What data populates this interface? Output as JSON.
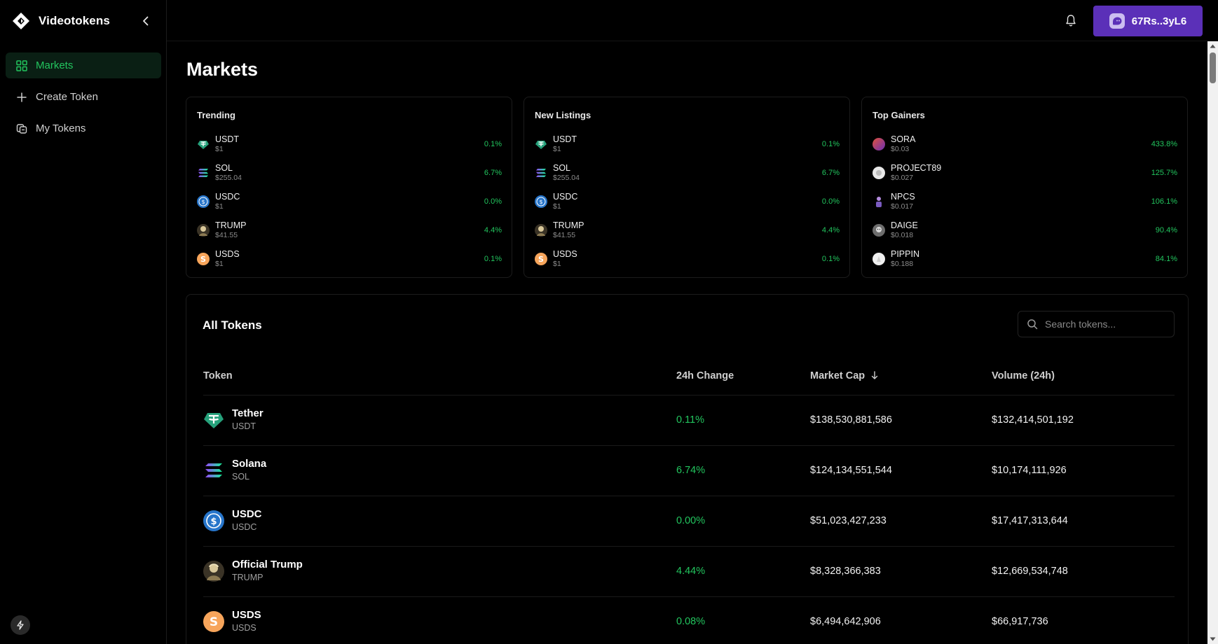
{
  "brand": {
    "name": "Videotokens",
    "logo_icon": "diamond-logo-icon"
  },
  "sidebar": {
    "items": [
      {
        "label": "Markets",
        "icon": "grid-icon",
        "active": true
      },
      {
        "label": "Create Token",
        "icon": "plus-icon",
        "active": false
      },
      {
        "label": "My Tokens",
        "icon": "coins-icon",
        "active": false
      }
    ]
  },
  "topbar": {
    "wallet_label": "67Rs..3yL6",
    "bell_icon": "bell-icon"
  },
  "page": {
    "title": "Markets"
  },
  "cards": [
    {
      "title": "Trending",
      "rows": [
        {
          "symbol": "USDT",
          "price": "$1",
          "change": "0.1%"
        },
        {
          "symbol": "SOL",
          "price": "$255.04",
          "change": "6.7%"
        },
        {
          "symbol": "USDC",
          "price": "$1",
          "change": "0.0%"
        },
        {
          "symbol": "TRUMP",
          "price": "$41.55",
          "change": "4.4%"
        },
        {
          "symbol": "USDS",
          "price": "$1",
          "change": "0.1%"
        }
      ]
    },
    {
      "title": "New Listings",
      "rows": [
        {
          "symbol": "USDT",
          "price": "$1",
          "change": "0.1%"
        },
        {
          "symbol": "SOL",
          "price": "$255.04",
          "change": "6.7%"
        },
        {
          "symbol": "USDC",
          "price": "$1",
          "change": "0.0%"
        },
        {
          "symbol": "TRUMP",
          "price": "$41.55",
          "change": "4.4%"
        },
        {
          "symbol": "USDS",
          "price": "$1",
          "change": "0.1%"
        }
      ]
    },
    {
      "title": "Top Gainers",
      "rows": [
        {
          "symbol": "SORA",
          "price": "$0.03",
          "change": "433.8%"
        },
        {
          "symbol": "PROJECT89",
          "price": "$0.027",
          "change": "125.7%"
        },
        {
          "symbol": "NPCS",
          "price": "$0.017",
          "change": "106.1%"
        },
        {
          "symbol": "DAIGE",
          "price": "$0.018",
          "change": "90.4%"
        },
        {
          "symbol": "PIPPIN",
          "price": "$0.188",
          "change": "84.1%"
        }
      ]
    }
  ],
  "all_tokens": {
    "title": "All Tokens",
    "search_placeholder": "Search tokens...",
    "columns": {
      "token": "Token",
      "change": "24h Change",
      "market_cap": "Market Cap",
      "volume": "Volume (24h)"
    },
    "sort_icon": "arrow-down-icon",
    "rows": [
      {
        "name": "Tether",
        "symbol": "USDT",
        "change": "0.11%",
        "market_cap": "$138,530,881,586",
        "volume": "$132,414,501,192"
      },
      {
        "name": "Solana",
        "symbol": "SOL",
        "change": "6.74%",
        "market_cap": "$124,134,551,544",
        "volume": "$10,174,111,926"
      },
      {
        "name": "USDC",
        "symbol": "USDC",
        "change": "0.00%",
        "market_cap": "$51,023,427,233",
        "volume": "$17,417,313,644"
      },
      {
        "name": "Official Trump",
        "symbol": "TRUMP",
        "change": "4.44%",
        "market_cap": "$8,328,366,383",
        "volume": "$12,669,534,748"
      },
      {
        "name": "USDS",
        "symbol": "USDS",
        "change": "0.08%",
        "market_cap": "$6,494,642,906",
        "volume": "$66,917,736"
      }
    ]
  },
  "colors": {
    "accent_green": "#22c55e",
    "wallet_purple": "#5b30b8",
    "background": "#000000"
  }
}
